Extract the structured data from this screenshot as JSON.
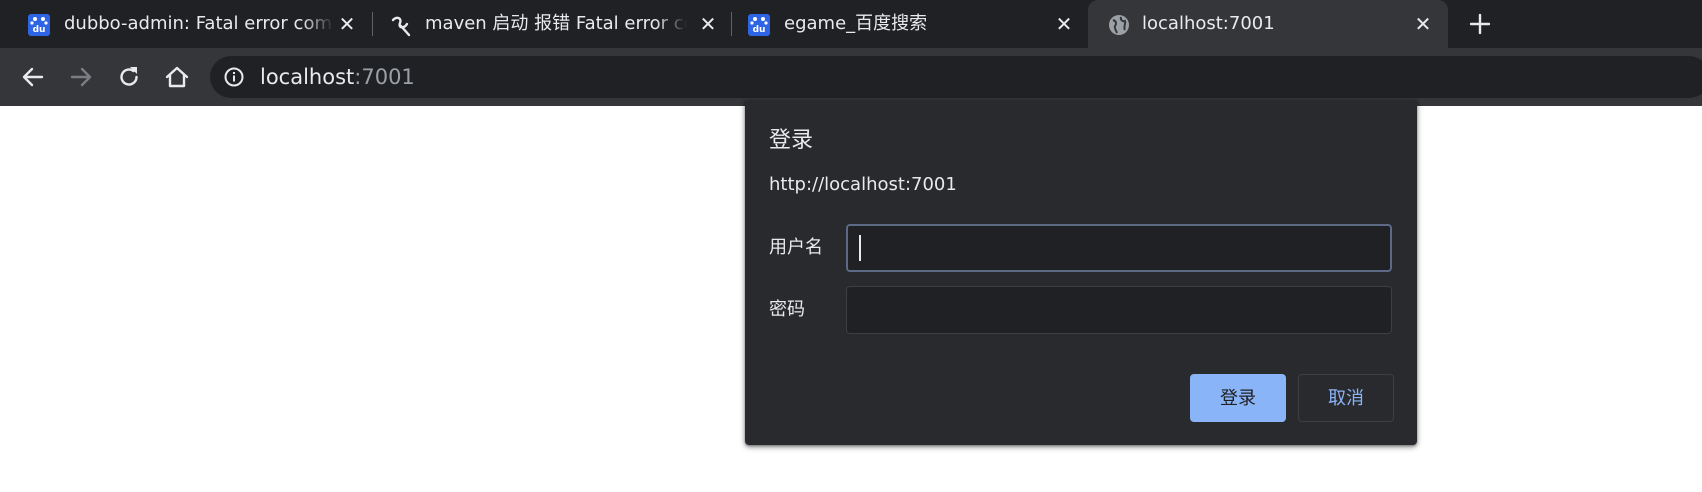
{
  "browser": {
    "tabs": [
      {
        "title": "dubbo-admin: Fatal error comp",
        "favicon": "baidu-paw-icon",
        "favicon_text": "du",
        "active": false
      },
      {
        "title": "maven 启动 报错 Fatal error co",
        "favicon": "csdn-logo-icon",
        "active": false
      },
      {
        "title": "egame_百度搜索",
        "favicon": "baidu-paw-icon",
        "favicon_text": "du",
        "active": false
      },
      {
        "title": "localhost:7001",
        "favicon": "globe-icon",
        "active": true
      }
    ],
    "new_tab_icon": "plus-icon",
    "toolbar": {
      "back_icon": "arrow-left-icon",
      "forward_icon": "arrow-right-icon",
      "reload_icon": "reload-icon",
      "home_icon": "home-icon",
      "site_info_icon": "info-circle-icon"
    },
    "address": {
      "host": "localhost",
      "port": ":7001"
    }
  },
  "login_dialog": {
    "title": "登录",
    "origin": "http://localhost:7001",
    "username_label": "用户名",
    "username_value": "",
    "password_label": "密码",
    "password_value": "",
    "submit_label": "登录",
    "cancel_label": "取消"
  },
  "colors": {
    "tabstrip_bg": "#202124",
    "toolbar_bg": "#35363a",
    "dialog_bg": "#292a2d",
    "accent": "#8ab4f8",
    "text": "#e8eaed"
  }
}
